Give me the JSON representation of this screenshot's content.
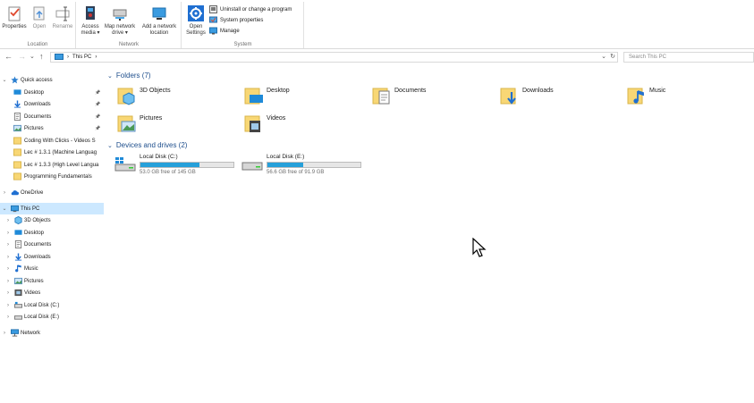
{
  "ribbon": {
    "location": {
      "label": "Location",
      "buttons": [
        {
          "label": "Properties",
          "icon": "properties-icon"
        },
        {
          "label": "Open",
          "icon": "open-icon"
        },
        {
          "label": "Rename",
          "icon": "rename-icon"
        }
      ]
    },
    "network": {
      "label": "Network",
      "buttons": [
        {
          "label": "Access media ▾",
          "icon": "access-media-icon"
        },
        {
          "label": "Map network drive ▾",
          "icon": "map-network-drive-icon"
        },
        {
          "label": "Add a network location",
          "icon": "add-network-location-icon"
        }
      ]
    },
    "system": {
      "label": "System",
      "open_settings": "Open Settings",
      "uninstall": "Uninstall or change a program",
      "system_properties": "System properties",
      "manage": "Manage"
    }
  },
  "address": {
    "back": "←",
    "forward": "→",
    "recent": "⌄",
    "up": "↑",
    "path": "This PC",
    "sep": "›",
    "dropdown": "⌄",
    "refresh": "↻",
    "search_placeholder": "Search This PC"
  },
  "sidebar": {
    "quick_access": "Quick access",
    "quick_items": [
      {
        "label": "Desktop",
        "pinned": true
      },
      {
        "label": "Downloads",
        "pinned": true
      },
      {
        "label": "Documents",
        "pinned": true
      },
      {
        "label": "Pictures",
        "pinned": true
      },
      {
        "label": "Coding With Clicks - Videos S",
        "pinned": false
      },
      {
        "label": "Lec # 1.3.1 (Machine Languag",
        "pinned": false
      },
      {
        "label": "Lec # 1.3.3 (High Level Langua",
        "pinned": false
      },
      {
        "label": "Programming Fundamentals",
        "pinned": false
      }
    ],
    "pin_glyph": "📌",
    "onedrive": "OneDrive",
    "this_pc": "This PC",
    "pc_items": [
      "3D Objects",
      "Desktop",
      "Documents",
      "Downloads",
      "Music",
      "Pictures",
      "Videos",
      "Local Disk (C:)",
      "Local Disk (E:)"
    ],
    "network": "Network"
  },
  "content": {
    "folders_header": "Folders (7)",
    "folders": [
      "3D Objects",
      "Desktop",
      "Documents",
      "Downloads",
      "Music",
      "Pictures",
      "Videos"
    ],
    "drives_header": "Devices and drives (2)",
    "drives": [
      {
        "name": "Local Disk (C:)",
        "free": "53.0 GB free of 145 GB",
        "used_fraction": 0.634
      },
      {
        "name": "Local Disk (E:)",
        "free": "56.6 GB free of 91.9 GB",
        "used_fraction": 0.384
      }
    ]
  },
  "colors": {
    "accent": "#26a0da",
    "folder": "#f8d775",
    "selected": "#cce8ff",
    "section": "#1e4e8c"
  }
}
